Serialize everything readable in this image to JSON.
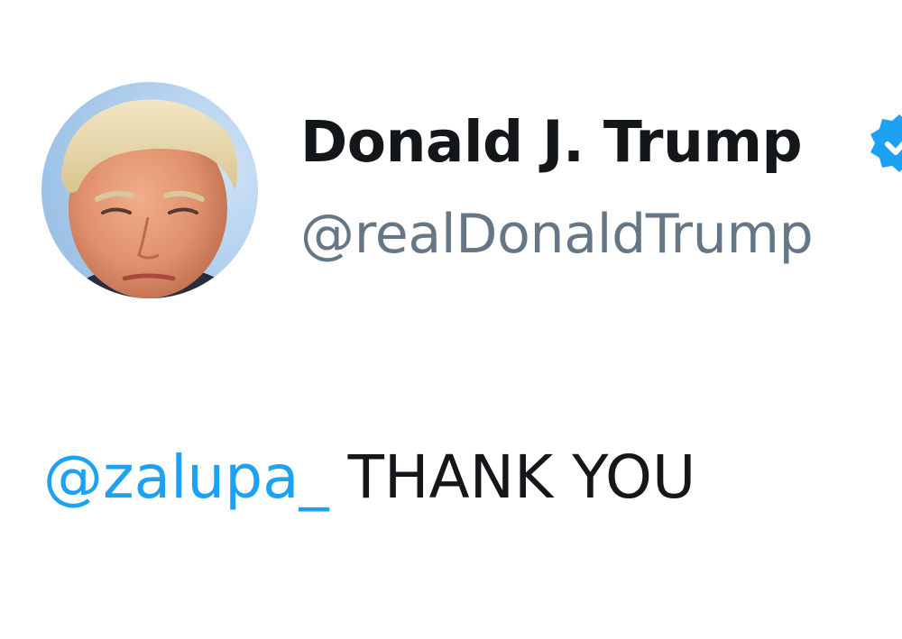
{
  "tweet": {
    "author": {
      "display_name": "Donald J. Trump",
      "handle": "@realDonaldTrump",
      "avatar_icon": "profile-photo",
      "verified_icon": "verified-badge-icon"
    },
    "text": {
      "mention": "@zalupa_",
      "body": " THANK YOU"
    }
  },
  "colors": {
    "name": "#14171a",
    "handle": "#657786",
    "mention": "#1da1f2",
    "verified": "#1da1f2",
    "background": "#ffffff"
  }
}
